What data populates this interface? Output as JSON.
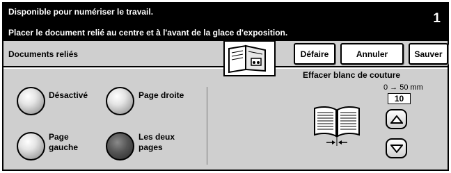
{
  "status": {
    "line1": "Disponible pour numériser le travail.",
    "line2": "Placer le document relié au centre et à l'avant de la glace d'exposition.",
    "job_number": "1"
  },
  "header": {
    "title": "Documents reliés",
    "buttons": {
      "defaire": "Défaire",
      "annuler": "Annuler",
      "sauver": "Sauver"
    }
  },
  "options": {
    "desactive": "Désactivé",
    "page_droite": "Page droite",
    "page_gauche_l1": "Page",
    "page_gauche_l2": "gauche",
    "les_deux_l1": "Les deux",
    "les_deux_l2": "pages",
    "selected": "Les deux pages"
  },
  "effacer": {
    "title": "Effacer blanc de couture",
    "range": "0 → 50 mm",
    "value": "10"
  },
  "colors": {
    "status_bg": "#000000",
    "panel_bg": "#cfcfcf"
  },
  "icons": [
    "up-arrow-icon",
    "down-arrow-icon",
    "open-book-icon",
    "bound-document-icon"
  ]
}
